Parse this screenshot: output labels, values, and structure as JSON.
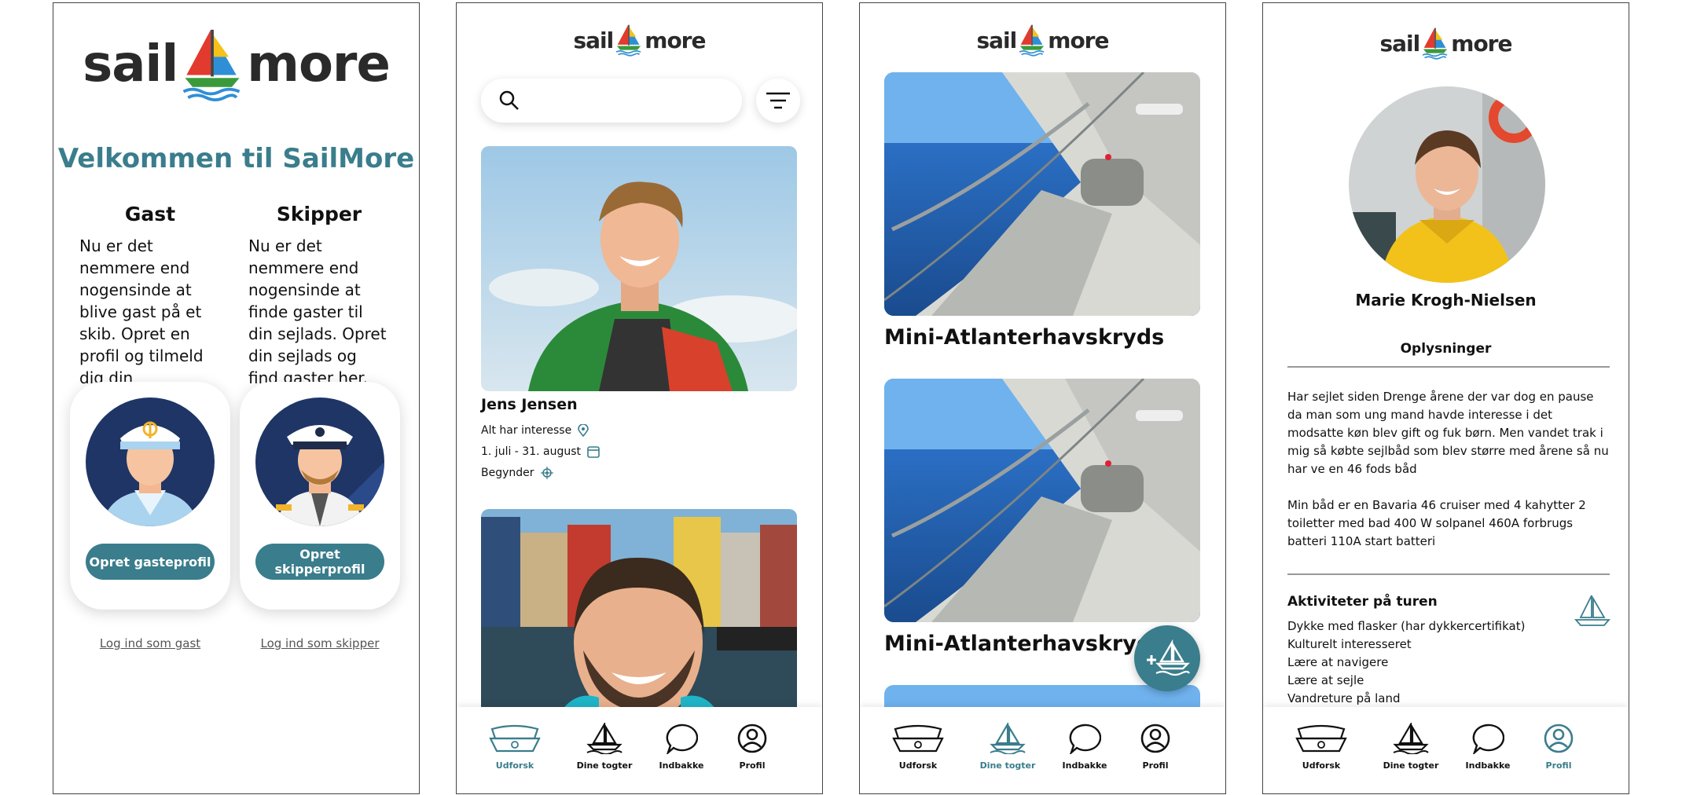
{
  "brand": {
    "logo_left": "sail",
    "logo_right": "more",
    "accent": "#3a7d8c"
  },
  "onboarding": {
    "welcome": "Velkommen til SailMore",
    "gast": {
      "title": "Gast",
      "text": "Nu er det nemmere end nogensinde at blive gast på et skib. Opret en profil og tilmeld dig din drømmesejlads!",
      "button": "Opret gasteprofil",
      "login": "Log ind som gast"
    },
    "skipper": {
      "title": "Skipper",
      "text": "Nu er det nemmere end nogensinde at finde gaster til din sejlads. Opret din sejlads og find gaster her.",
      "button": "Opret skipperprofil",
      "login": "Log ind som skipper"
    }
  },
  "explore": {
    "search_placeholder": "",
    "person": {
      "name": "Jens Jensen",
      "interest": "Alt har interesse",
      "dates": "1. juli - 31. august",
      "level": "Begynder"
    }
  },
  "trips": {
    "items": [
      {
        "title": "Mini-Atlanterhavskryds"
      },
      {
        "title": "Mini-Atlanterhavskryds"
      }
    ]
  },
  "profile": {
    "name": "Marie Krogh-Nielsen",
    "section": "Oplysninger",
    "bio1": "Har sejlet siden Drenge årene der var dog en pause da man som ung mand havde interesse i det modsatte køn blev gift og fuk børn. Men vandet trak i mig så købte sejlbåd som blev større med årene så nu har ve en 46 fods båd",
    "bio2": "Min båd er en Bavaria 46 cruiser med 4 kahytter 2 toiletter med bad 400 W solpanel 460A forbrugs batteri 110A start batteri",
    "activities_title": "Aktiviteter på turen",
    "activities": [
      "Dykke med flasker (har dykkercertifikat)",
      "Kulturelt interesseret",
      "Lære at navigere",
      "Lære at sejle",
      "Vandreture på land"
    ]
  },
  "nav": {
    "explore": "Udforsk",
    "trips": "Dine togter",
    "inbox": "Indbakke",
    "profile": "Profil"
  }
}
